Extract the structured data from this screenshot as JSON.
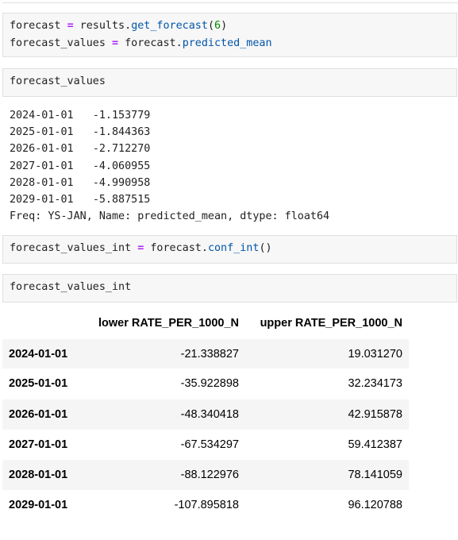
{
  "cells": {
    "forecast_code": {
      "line1": {
        "var": "forecast",
        "op": "=",
        "obj": "results.",
        "fn": "get_forecast",
        "open": "(",
        "arg": "6",
        "close": ")"
      },
      "line2": {
        "var": "forecast_values",
        "op": "=",
        "obj": "forecast.",
        "attr": "predicted_mean"
      }
    },
    "values_code": {
      "text": "forecast_values"
    },
    "values_output": {
      "rows": [
        {
          "date": "2024-01-01",
          "value": "-1.153779"
        },
        {
          "date": "2025-01-01",
          "value": "-1.844363"
        },
        {
          "date": "2026-01-01",
          "value": "-2.712270"
        },
        {
          "date": "2027-01-01",
          "value": "-4.060955"
        },
        {
          "date": "2028-01-01",
          "value": "-4.990958"
        },
        {
          "date": "2029-01-01",
          "value": "-5.887515"
        }
      ],
      "footer": "Freq: YS-JAN, Name: predicted_mean, dtype: float64"
    },
    "conf_code": {
      "var": "forecast_values_int",
      "op": "=",
      "obj": "forecast.",
      "fn": "conf_int",
      "call": "()"
    },
    "int_code": {
      "text": "forecast_values_int"
    }
  },
  "table": {
    "columns": [
      "",
      "lower RATE_PER_1000_N",
      "upper RATE_PER_1000_N"
    ],
    "rows": [
      {
        "index": "2024-01-01",
        "lower": "-21.338827",
        "upper": "19.031270"
      },
      {
        "index": "2025-01-01",
        "lower": "-35.922898",
        "upper": "32.234173"
      },
      {
        "index": "2026-01-01",
        "lower": "-48.340418",
        "upper": "42.915878"
      },
      {
        "index": "2027-01-01",
        "lower": "-67.534297",
        "upper": "59.412387"
      },
      {
        "index": "2028-01-01",
        "lower": "-88.122976",
        "upper": "78.141059"
      },
      {
        "index": "2029-01-01",
        "lower": "-107.895818",
        "upper": "96.120788"
      }
    ]
  }
}
